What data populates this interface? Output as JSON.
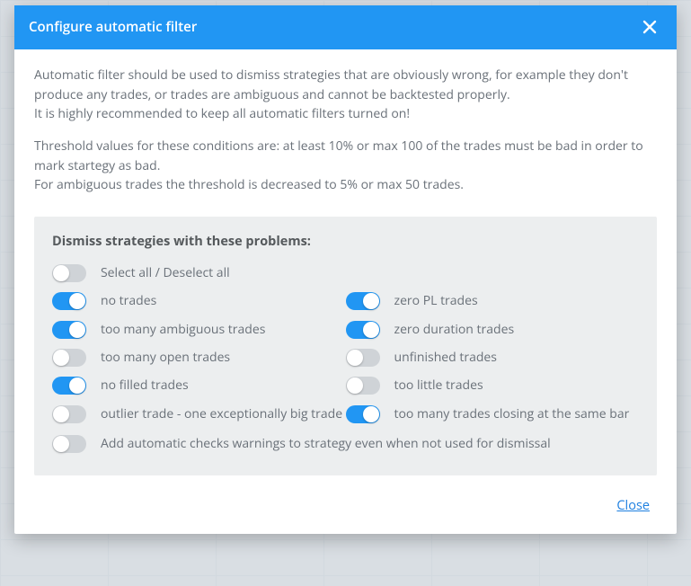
{
  "header": {
    "title": "Configure automatic filter"
  },
  "intro": {
    "p1": "Automatic filter should be used to dismiss strategies that are obviously wrong, for example they don't produce any trades, or trades are ambiguous and cannot be backtested properly.",
    "p1b": "It is highly recommended to keep all automatic filters turned on!",
    "p2": "Threshold values for these conditions are: at least 10% or max 100 of the trades must be bad in order to mark startegy as bad.",
    "p2b": "For ambiguous trades the threshold is decreased to 5% or max 50 trades."
  },
  "panel": {
    "title": "Dismiss strategies with these problems:",
    "select_all_label": "Select all / Deselect all",
    "select_all_on": false,
    "left": [
      {
        "label": "no trades",
        "on": true
      },
      {
        "label": "too many ambiguous trades",
        "on": true
      },
      {
        "label": "too many open trades",
        "on": false
      },
      {
        "label": "no filled trades",
        "on": true
      },
      {
        "label": "outlier trade - one exceptionally big trade",
        "on": false
      }
    ],
    "right": [
      {
        "label": "zero PL trades",
        "on": true
      },
      {
        "label": "zero duration trades",
        "on": true
      },
      {
        "label": "unfinished trades",
        "on": false
      },
      {
        "label": "too little trades",
        "on": false
      },
      {
        "label": "too many trades closing at the same bar",
        "on": true
      }
    ],
    "footer_opt": {
      "label": "Add automatic checks warnings to strategy even when not used for dismissal",
      "on": false
    }
  },
  "footer": {
    "close": "Close"
  }
}
